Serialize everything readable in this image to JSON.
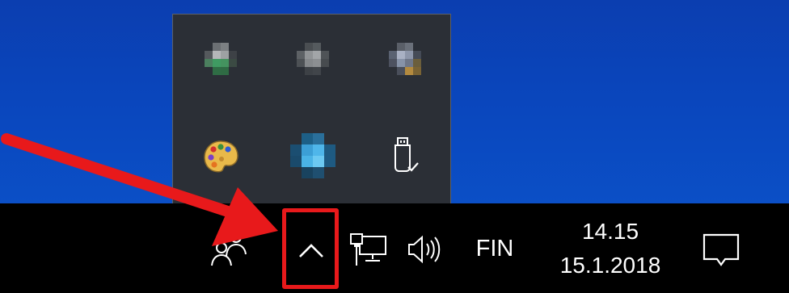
{
  "taskbar": {
    "language": "FIN",
    "clock": {
      "time": "14.15",
      "date": "15.1.2018"
    }
  },
  "tray_flyout": {
    "icons": [
      {
        "name": "blurred-app-icon-1"
      },
      {
        "name": "blurred-app-icon-2"
      },
      {
        "name": "blurred-app-icon-3"
      },
      {
        "name": "paint-palette-icon"
      },
      {
        "name": "blurred-app-icon-4"
      },
      {
        "name": "safely-remove-hardware-icon"
      }
    ]
  },
  "colors": {
    "desktop": "#0b47be",
    "taskbar": "#000000",
    "flyout": "#2b2f36",
    "annotation_red": "#e8191b"
  }
}
